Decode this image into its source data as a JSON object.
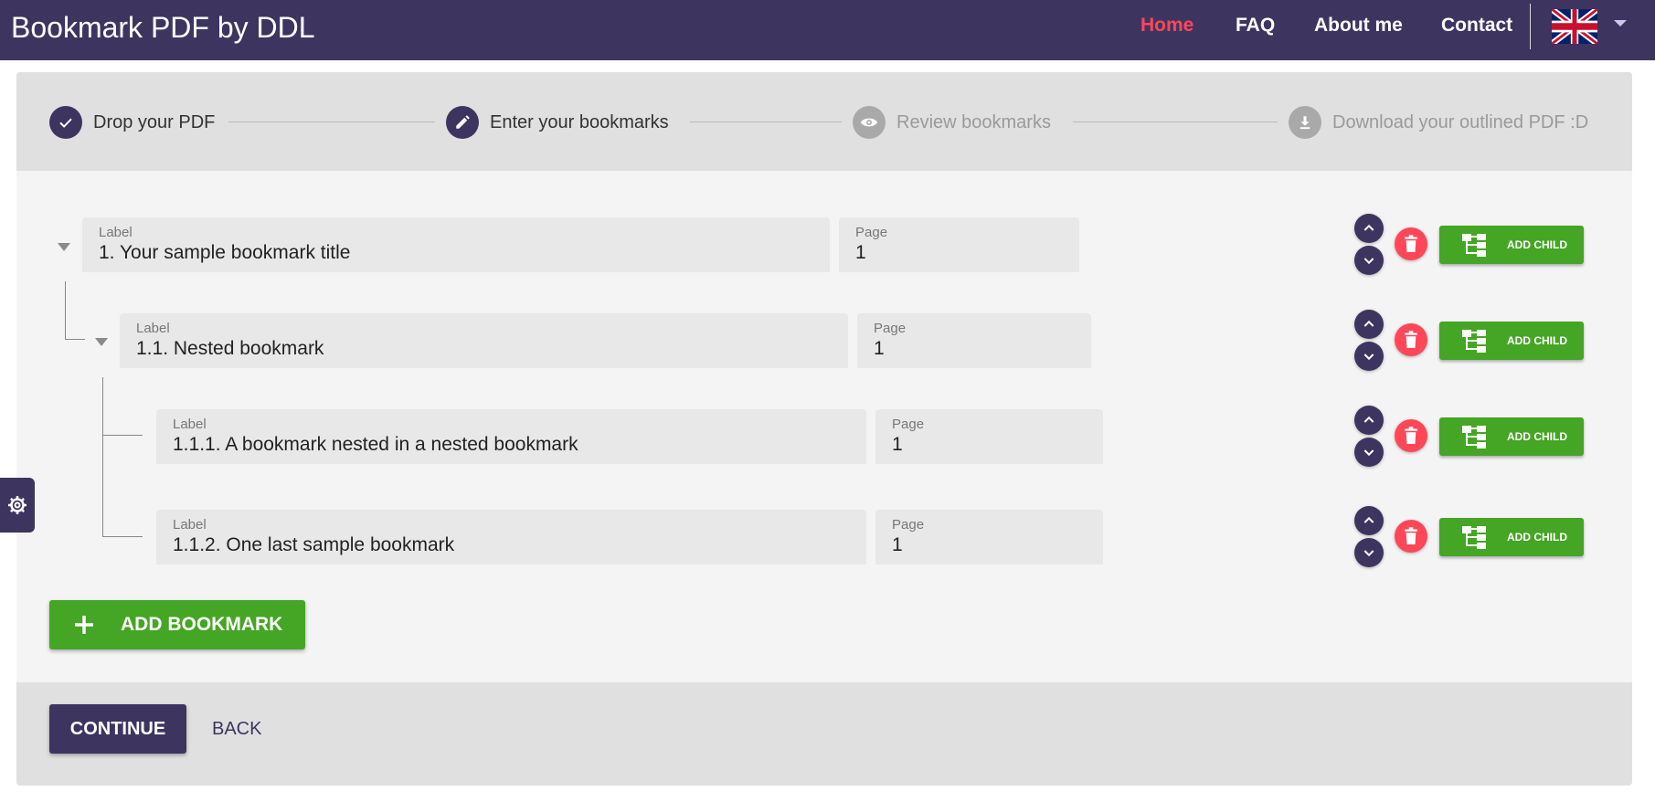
{
  "header": {
    "brand": "Bookmark PDF by DDL",
    "nav": [
      "Home",
      "FAQ",
      "About me",
      "Contact"
    ],
    "active_nav": "Home",
    "language": "English (UK flag)",
    "colors": {
      "header_bg": "#3d3560",
      "active_link": "#ff4757"
    }
  },
  "stepper": {
    "steps": [
      {
        "label": "Drop your PDF",
        "state": "completed",
        "icon": "check-icon"
      },
      {
        "label": "Enter your bookmarks",
        "state": "active",
        "icon": "pencil-icon"
      },
      {
        "label": "Review bookmarks",
        "state": "inactive",
        "icon": "eye-icon"
      },
      {
        "label": "Download your outlined PDF :D",
        "state": "inactive",
        "icon": "download-icon"
      }
    ]
  },
  "bookmarks": [
    {
      "label_caption": "Label",
      "label": "1. Your sample bookmark title",
      "page_caption": "Page",
      "page": "1",
      "level": 0
    },
    {
      "label_caption": "Label",
      "label": "1.1. Nested bookmark",
      "page_caption": "Page",
      "page": "1",
      "level": 1
    },
    {
      "label_caption": "Label",
      "label": "1.1.1. A bookmark nested in a nested bookmark",
      "page_caption": "Page",
      "page": "1",
      "level": 2
    },
    {
      "label_caption": "Label",
      "label": "1.1.2. One last sample bookmark",
      "page_caption": "Page",
      "page": "1",
      "level": 2
    }
  ],
  "row_actions": {
    "add_child": "ADD CHILD",
    "icons": [
      "chevron-up-icon",
      "chevron-down-icon",
      "trash-icon",
      "hierarchy-icon"
    ]
  },
  "add_bookmark": "ADD BOOKMARK",
  "footer": {
    "continue": "CONTINUE",
    "back": "BACK"
  },
  "side_tab_icon": "gear-icon",
  "colors": {
    "primary": "#3d3560",
    "green": "#45a524",
    "danger": "#ff4757"
  }
}
